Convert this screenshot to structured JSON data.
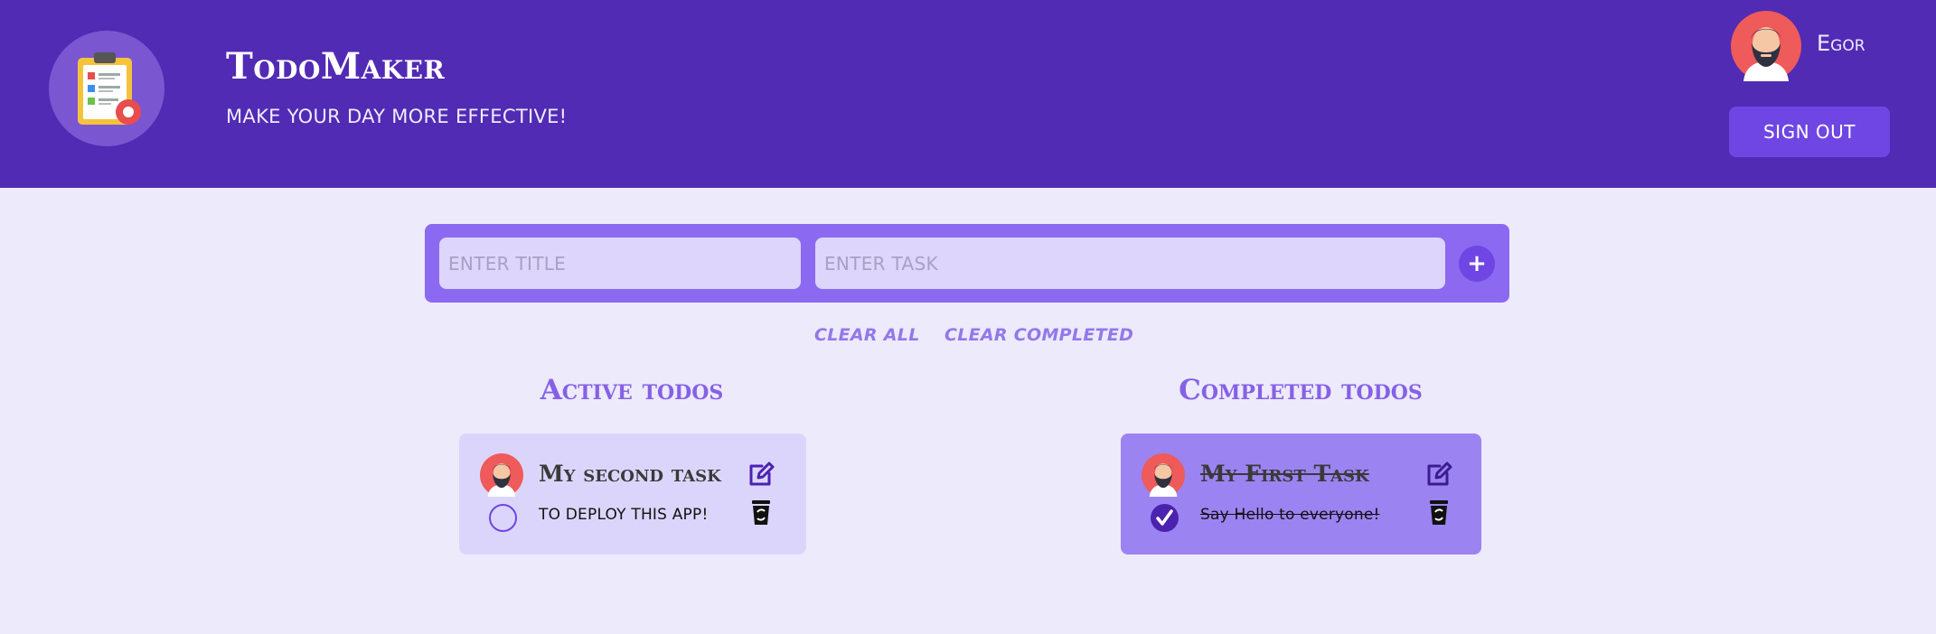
{
  "app": {
    "title": "TodoMaker",
    "subtitle": "MAKE YOUR DAY MORE EFFECTIVE!",
    "logo_icon": "clipboard-gear-icon"
  },
  "user": {
    "name": "Egor",
    "avatar_icon": "bearded-man-avatar",
    "signout_label": "SIGN OUT"
  },
  "entry": {
    "title_placeholder": "ENTER TITLE",
    "task_placeholder": "ENTER TASK",
    "add_label": "+"
  },
  "actions": {
    "clear_all": "CLEAR ALL",
    "clear_completed": "CLEAR COMPLETED"
  },
  "sections": {
    "active_title": "Active todos",
    "completed_title": "Completed todos"
  },
  "todos": {
    "active": [
      {
        "title": "My second task",
        "description": "TO DEPLOY THIS APP!",
        "completed": false
      }
    ],
    "completed": [
      {
        "title": "My First Task",
        "description": "Say Hello to everyone!",
        "completed": true
      }
    ]
  },
  "colors": {
    "header": "#512bb4",
    "page_background": "#edeafc",
    "accent": "#6f46e3",
    "entry_bar": "#8b69f0",
    "active_card": "#dcd5fb",
    "completed_card": "#9c83f2"
  }
}
